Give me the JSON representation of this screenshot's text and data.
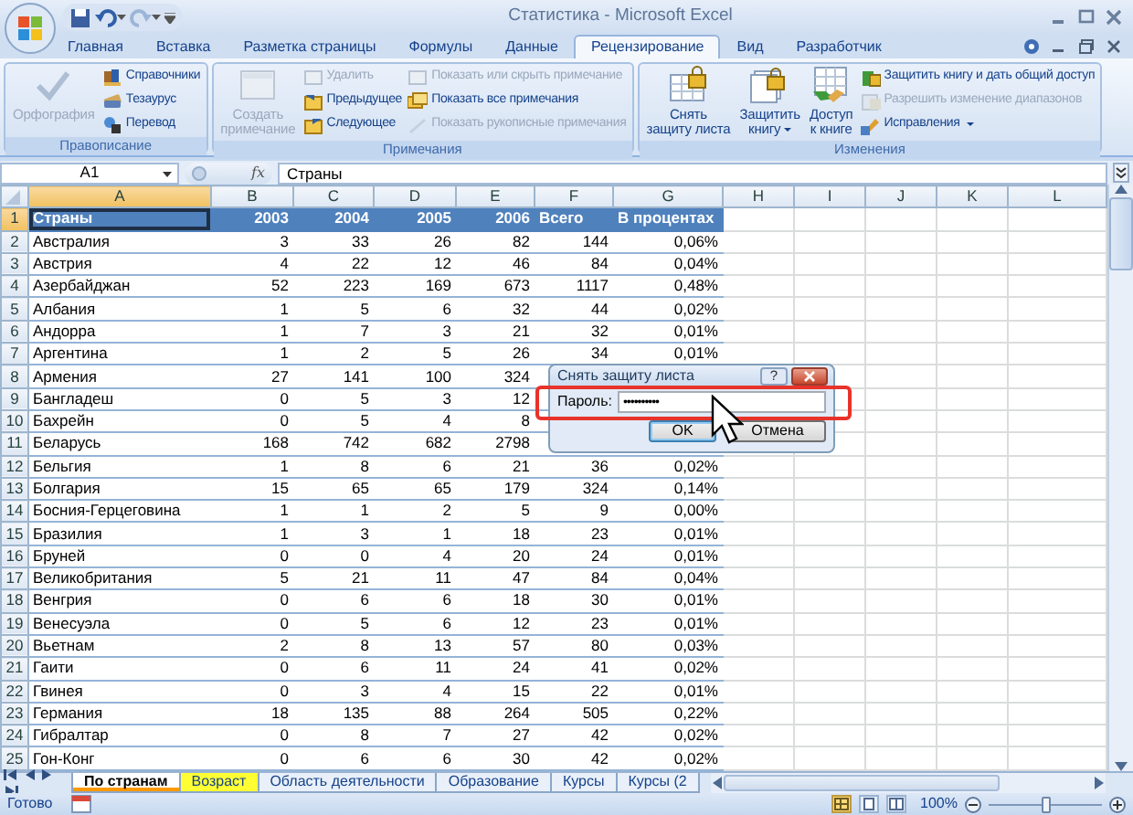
{
  "title_bar": {
    "title": "Статистика - Microsoft Excel"
  },
  "quick_access": [
    {
      "disabled": false
    },
    {
      "disabled": false
    },
    {
      "disabled": true
    }
  ],
  "ribbon_tabs": [
    {
      "label": "Главная",
      "selected": false
    },
    {
      "label": "Вставка",
      "selected": false
    },
    {
      "label": "Разметка страницы",
      "selected": false
    },
    {
      "label": "Формулы",
      "selected": false
    },
    {
      "label": "Данные",
      "selected": false
    },
    {
      "label": "Рецензирование",
      "selected": true
    },
    {
      "label": "Вид",
      "selected": false
    },
    {
      "label": "Разработчик",
      "selected": false
    }
  ],
  "ribbon_groups": [
    {
      "label": "Правописание",
      "large_buttons": [
        {
          "label_lines": [
            "Орфография"
          ],
          "disabled": true,
          "dropdown": false
        }
      ],
      "small_columns": [
        [
          {
            "label": "Справочники",
            "disabled": false,
            "dropdown": false
          },
          {
            "label": "Тезаурус",
            "disabled": false,
            "dropdown": false
          },
          {
            "label": "Перевод",
            "disabled": false,
            "dropdown": false
          }
        ]
      ]
    },
    {
      "label": "Примечания",
      "large_buttons": [
        {
          "label_lines": [
            "Создать",
            "примечание"
          ],
          "disabled": true,
          "dropdown": false
        }
      ],
      "small_columns": [
        [
          {
            "label": "Удалить",
            "disabled": true,
            "dropdown": false
          },
          {
            "label": "Предыдущее",
            "disabled": false,
            "dropdown": false
          },
          {
            "label": "Следующее",
            "disabled": false,
            "dropdown": false
          }
        ],
        [
          {
            "label": "Показать или скрыть примечание",
            "disabled": true,
            "dropdown": false
          },
          {
            "label": "Показать все примечания",
            "disabled": false,
            "dropdown": false
          },
          {
            "label": "Показать рукописные примечания",
            "disabled": true,
            "dropdown": false
          }
        ]
      ]
    },
    {
      "label": "Изменения",
      "large_buttons": [
        {
          "label_lines": [
            "Снять",
            "защиту листа"
          ],
          "disabled": false,
          "dropdown": false
        },
        {
          "label_lines": [
            "Защитить",
            "книгу"
          ],
          "disabled": false,
          "dropdown": true
        },
        {
          "label_lines": [
            "Доступ",
            "к книге"
          ],
          "disabled": false,
          "dropdown": false
        }
      ],
      "small_columns": [
        [
          {
            "label": "Защитить книгу и дать общий доступ",
            "disabled": false,
            "dropdown": false
          },
          {
            "label": "Разрешить изменение диапазонов",
            "disabled": true,
            "dropdown": false
          },
          {
            "label": "Исправления",
            "disabled": false,
            "dropdown": true
          }
        ]
      ]
    }
  ],
  "formula_bar": {
    "name_box": "A1",
    "function_label": "fx",
    "content": "Страны"
  },
  "columns": [
    {
      "label": "A",
      "selected": true
    },
    {
      "label": "B",
      "selected": false
    },
    {
      "label": "C",
      "selected": false
    },
    {
      "label": "D",
      "selected": false
    },
    {
      "label": "E",
      "selected": false
    },
    {
      "label": "F",
      "selected": false
    },
    {
      "label": "G",
      "selected": false
    },
    {
      "label": "H",
      "selected": false
    },
    {
      "label": "I",
      "selected": false
    },
    {
      "label": "J",
      "selected": false
    },
    {
      "label": "K",
      "selected": false
    },
    {
      "label": "L",
      "selected": false
    }
  ],
  "rows": [
    {
      "number": "1",
      "selected": true,
      "kind": "header",
      "cells": [
        "Страны",
        "2003",
        "2004",
        "2005",
        "2006",
        "Всего",
        "В процентах"
      ]
    },
    {
      "number": "2",
      "selected": false,
      "kind": "data",
      "cells": [
        "Австралия",
        "3",
        "33",
        "26",
        "82",
        "144",
        "0,06%"
      ]
    },
    {
      "number": "3",
      "selected": false,
      "kind": "data",
      "cells": [
        "Австрия",
        "4",
        "22",
        "12",
        "46",
        "84",
        "0,04%"
      ]
    },
    {
      "number": "4",
      "selected": false,
      "kind": "data",
      "cells": [
        "Азербайджан",
        "52",
        "223",
        "169",
        "673",
        "1117",
        "0,48%"
      ]
    },
    {
      "number": "5",
      "selected": false,
      "kind": "data",
      "cells": [
        "Албания",
        "1",
        "5",
        "6",
        "32",
        "44",
        "0,02%"
      ]
    },
    {
      "number": "6",
      "selected": false,
      "kind": "data",
      "cells": [
        "Андорра",
        "1",
        "7",
        "3",
        "21",
        "32",
        "0,01%"
      ]
    },
    {
      "number": "7",
      "selected": false,
      "kind": "data",
      "cells": [
        "Аргентина",
        "1",
        "2",
        "5",
        "26",
        "34",
        "0,01%"
      ]
    },
    {
      "number": "8",
      "selected": false,
      "kind": "data",
      "cells": [
        "Армения",
        "27",
        "141",
        "100",
        "324"
      ]
    },
    {
      "number": "9",
      "selected": false,
      "kind": "data",
      "cells": [
        "Бангладеш",
        "0",
        "5",
        "3",
        "12"
      ]
    },
    {
      "number": "10",
      "selected": false,
      "kind": "data",
      "cells": [
        "Бахрейн",
        "0",
        "5",
        "4",
        "8"
      ]
    },
    {
      "number": "11",
      "selected": false,
      "kind": "data",
      "cells": [
        "Беларусь",
        "168",
        "742",
        "682",
        "2798"
      ]
    },
    {
      "number": "12",
      "selected": false,
      "kind": "data",
      "cells": [
        "Бельгия",
        "1",
        "8",
        "6",
        "21",
        "36",
        "0,02%"
      ]
    },
    {
      "number": "13",
      "selected": false,
      "kind": "data",
      "cells": [
        "Болгария",
        "15",
        "65",
        "65",
        "179",
        "324",
        "0,14%"
      ]
    },
    {
      "number": "14",
      "selected": false,
      "kind": "data",
      "cells": [
        "Босния-Герцеговина",
        "1",
        "1",
        "2",
        "5",
        "9",
        "0,00%"
      ]
    },
    {
      "number": "15",
      "selected": false,
      "kind": "data",
      "cells": [
        "Бразилия",
        "1",
        "3",
        "1",
        "18",
        "23",
        "0,01%"
      ]
    },
    {
      "number": "16",
      "selected": false,
      "kind": "data",
      "cells": [
        "Бруней",
        "0",
        "0",
        "4",
        "20",
        "24",
        "0,01%"
      ]
    },
    {
      "number": "17",
      "selected": false,
      "kind": "data",
      "cells": [
        "Великобритания",
        "5",
        "21",
        "11",
        "47",
        "84",
        "0,04%"
      ]
    },
    {
      "number": "18",
      "selected": false,
      "kind": "data",
      "cells": [
        "Венгрия",
        "0",
        "6",
        "6",
        "18",
        "30",
        "0,01%"
      ]
    },
    {
      "number": "19",
      "selected": false,
      "kind": "data",
      "cells": [
        "Венесуэла",
        "0",
        "5",
        "6",
        "12",
        "23",
        "0,01%"
      ]
    },
    {
      "number": "20",
      "selected": false,
      "kind": "data",
      "cells": [
        "Вьетнам",
        "2",
        "8",
        "13",
        "57",
        "80",
        "0,03%"
      ]
    },
    {
      "number": "21",
      "selected": false,
      "kind": "data",
      "cells": [
        "Гаити",
        "0",
        "6",
        "11",
        "24",
        "41",
        "0,02%"
      ]
    },
    {
      "number": "22",
      "selected": false,
      "kind": "data",
      "cells": [
        "Гвинея",
        "0",
        "3",
        "4",
        "15",
        "22",
        "0,01%"
      ]
    },
    {
      "number": "23",
      "selected": false,
      "kind": "data",
      "cells": [
        "Германия",
        "18",
        "135",
        "88",
        "264",
        "505",
        "0,22%"
      ]
    },
    {
      "number": "24",
      "selected": false,
      "kind": "data",
      "cells": [
        "Гибралтар",
        "0",
        "8",
        "7",
        "27",
        "42",
        "0,02%"
      ]
    },
    {
      "number": "25",
      "selected": false,
      "kind": "data",
      "cells": [
        "Гон-Конг",
        "0",
        "6",
        "6",
        "30",
        "42",
        "0,02%"
      ]
    }
  ],
  "dialog": {
    "title": "Снять защиту листа",
    "help": "?",
    "field_label": "Пароль:",
    "value": "••••••••••",
    "buttons": [
      {
        "label": "OK",
        "default": true
      },
      {
        "label": "Отмена",
        "default": false
      }
    ]
  },
  "sheet_tabs": [
    {
      "label": "По странам",
      "selected": true,
      "color": "#ff9900"
    },
    {
      "label": "Возраст",
      "selected": false,
      "color": "#ffff33"
    },
    {
      "label": "Область деятельности",
      "selected": false
    },
    {
      "label": "Образование",
      "selected": false
    },
    {
      "label": "Курсы",
      "selected": false
    },
    {
      "label": "Курсы (2",
      "selected": false
    }
  ],
  "status_bar": {
    "status": "Готово",
    "views": [
      {
        "selected": true
      },
      {
        "selected": false
      },
      {
        "selected": false
      }
    ],
    "zoom": "100%",
    "zoom_slider": {
      "level": 0.5
    }
  }
}
